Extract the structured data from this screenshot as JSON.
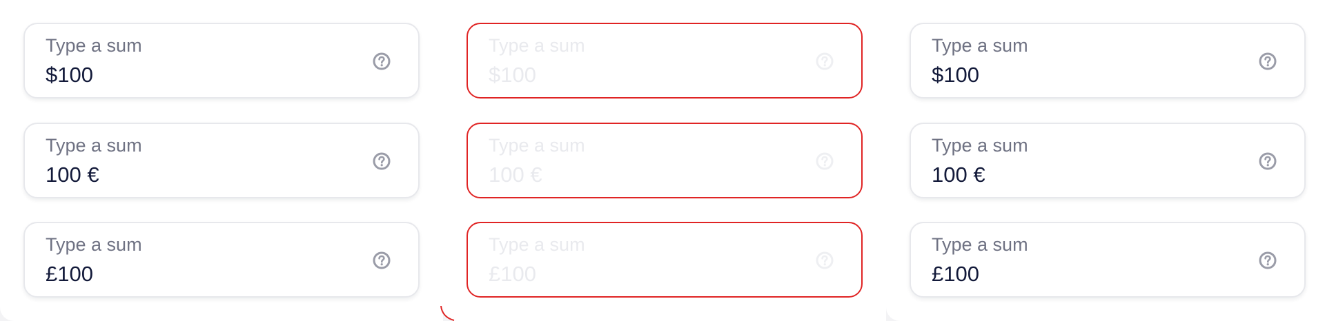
{
  "columns": [
    {
      "state": "default",
      "fields": [
        {
          "label": "Type a sum",
          "value": "$100",
          "icon": "help-circle-icon"
        },
        {
          "label": "Type a sum",
          "value": "100 €",
          "icon": "help-circle-icon"
        },
        {
          "label": "Type a sum",
          "value": "£100",
          "icon": "help-circle-icon"
        }
      ]
    },
    {
      "state": "error-disabled",
      "fields": [
        {
          "label": "Type a sum",
          "value": "$100",
          "icon": "help-circle-icon"
        },
        {
          "label": "Type a sum",
          "value": "100 €",
          "icon": "help-circle-icon"
        },
        {
          "label": "Type a sum",
          "value": "£100",
          "icon": "help-circle-icon"
        }
      ]
    },
    {
      "state": "default",
      "fields": [
        {
          "label": "Type a sum",
          "value": "$100",
          "icon": "help-circle-icon"
        },
        {
          "label": "Type a sum",
          "value": "100 €",
          "icon": "help-circle-icon"
        },
        {
          "label": "Type a sum",
          "value": "£100",
          "icon": "help-circle-icon"
        }
      ]
    }
  ],
  "colors": {
    "label": "#6f7283",
    "value": "#131a3a",
    "border": "#e7e8ec",
    "error_border": "#e02424",
    "disabled_text": "#e9eaee",
    "icon": "#9a9ca8",
    "icon_disabled": "#eeeff2"
  }
}
